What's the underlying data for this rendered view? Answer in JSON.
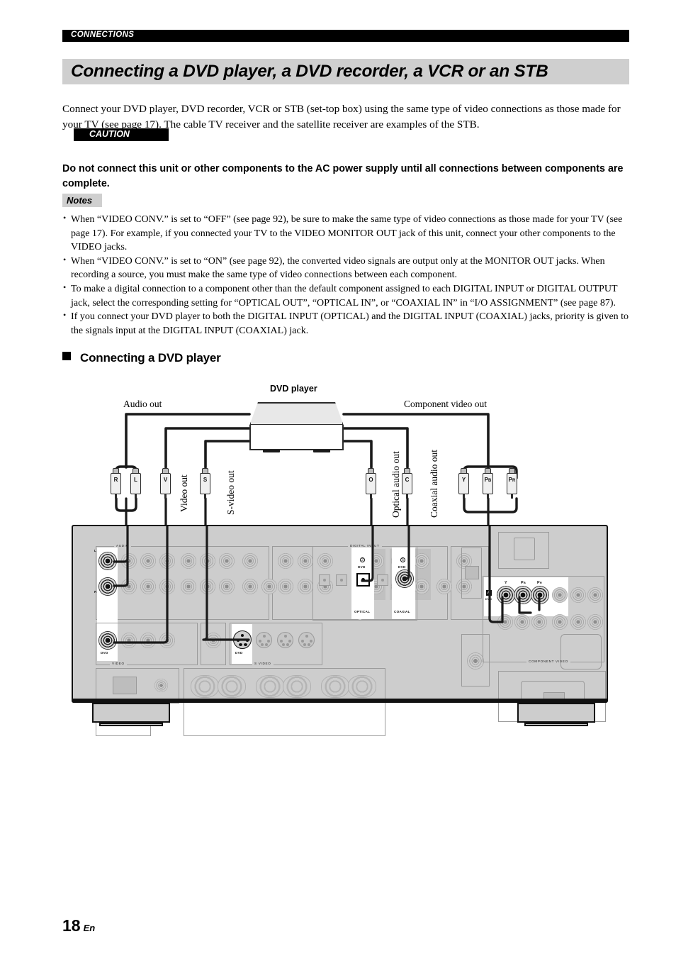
{
  "running_head": "CONNECTIONS",
  "title": "Connecting a DVD player, a DVD recorder, a VCR or an STB",
  "intro": "Connect your DVD player, DVD recorder, VCR or STB (set-top box) using the same type of video connections as those made for your TV (see page 17). The cable TV receiver and the satellite receiver are examples of the STB.",
  "caution": {
    "tag": "CAUTION",
    "text": "Do not connect this unit or other components to the AC power supply until all connections between components are complete."
  },
  "notes": {
    "tag": "Notes",
    "bullet": "•",
    "items": [
      "When “VIDEO CONV.” is set to “OFF” (see page 92), be sure to make the same type of video connections as those made for your TV (see page 17). For example, if you connected your TV to the VIDEO MONITOR OUT jack of this unit, connect your other components to the VIDEO jacks.",
      "When “VIDEO CONV.” is set to “ON” (see page 92), the converted video signals are output only at the MONITOR OUT jacks. When recording a source, you must make the same type of video connections between each component.",
      "To make a digital connection to a component other than the default component assigned to each DIGITAL INPUT or DIGITAL OUTPUT jack, select the corresponding setting for “OPTICAL OUT”, “OPTICAL IN”, or “COAXIAL IN” in “I/O ASSIGNMENT” (see page 87).",
      "If you connect your DVD player to both the DIGITAL INPUT (OPTICAL) and the DIGITAL INPUT (COAXIAL) jacks, priority is given to the signals input at the DIGITAL INPUT (COAXIAL) jack."
    ]
  },
  "section": {
    "heading": "Connecting a DVD player"
  },
  "figure": {
    "device_title": "DVD player",
    "label_audio_out": "Audio out",
    "label_component_video_out": "Component video out",
    "label_video_out": "Video out",
    "label_svideo_out": "S-video out",
    "label_optical_audio_out": "Optical audio out",
    "label_coaxial_audio_out": "Coaxial audio out",
    "plugs": {
      "right": "R",
      "left": "L",
      "video": "V",
      "svideo": "S",
      "optical": "O",
      "coaxial": "C",
      "y": "Y",
      "pb": "P",
      "pb_sub": "B",
      "pr": "P",
      "pr_sub": "R"
    },
    "panel": {
      "group_audio": "AUDIO",
      "group_video": "VIDEO",
      "group_svideo": "S VIDEO",
      "group_digital_input": "DIGITAL INPUT",
      "group_component_video": "COMPONENT VIDEO",
      "label_optical": "OPTICAL",
      "label_coaxial": "COAXIAL",
      "label_dvd": "DVD",
      "digital_optical_num": "2",
      "digital_coaxial_num": "5",
      "component_letter": "A",
      "component_y": "Y",
      "component_pb": "P",
      "component_pb_sub": "B",
      "component_pr": "P",
      "component_pr_sub": "R",
      "audio_left_mark": "L",
      "audio_right_mark": "R"
    }
  },
  "page_number": {
    "number": "18",
    "lang": "En"
  }
}
